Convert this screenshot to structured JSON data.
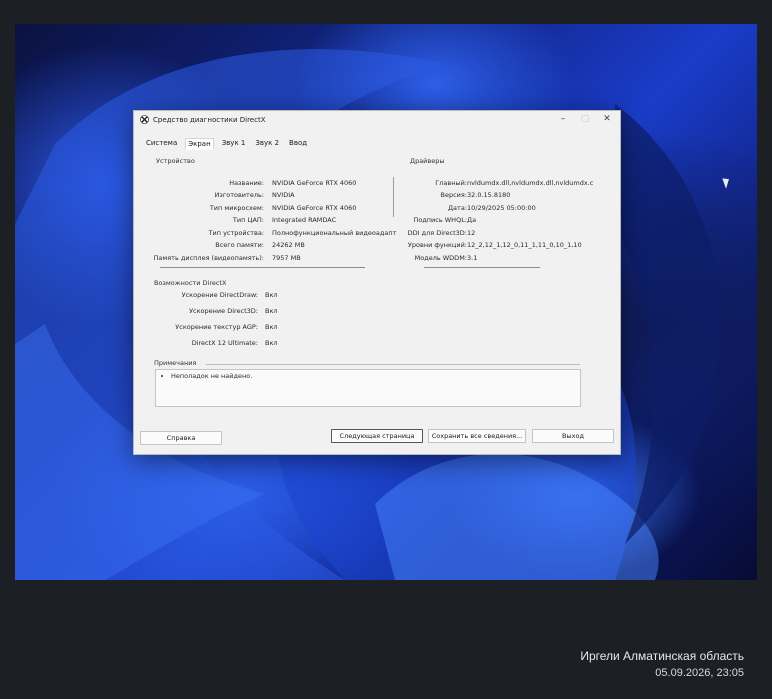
{
  "window": {
    "title": "Средство диагностики DirectX"
  },
  "tabs": [
    {
      "label": "Система"
    },
    {
      "label": "Экран"
    },
    {
      "label": "Звук 1"
    },
    {
      "label": "Звук 2"
    },
    {
      "label": "Ввод"
    }
  ],
  "device": {
    "section_title": "Устройство",
    "rows": [
      {
        "label": "Название:",
        "value": "NVIDIA GeForce RTX 4060"
      },
      {
        "label": "Изготовитель:",
        "value": "NVIDIA"
      },
      {
        "label": "Тип микросхем:",
        "value": "NVIDIA GeForce RTX 4060"
      },
      {
        "label": "Тип ЦАП:",
        "value": "Integrated RAMDAC"
      },
      {
        "label": "Тип устройства:",
        "value": "Полнофункциональный видеоадапт"
      },
      {
        "label": "Всего памяти:",
        "value": "24262 MB"
      },
      {
        "label": "Память дисплея (видеопамять):",
        "value": "7957 MB"
      }
    ]
  },
  "drivers": {
    "section_title": "Драйверы",
    "rows": [
      {
        "label": "Главный:",
        "value": "nvldumdx.dll,nvldumdx.dll,nvldumdx.c"
      },
      {
        "label": "Версия:",
        "value": "32.0.15.8180"
      },
      {
        "label": "Дата:",
        "value": "10/29/2025 05:00:00"
      },
      {
        "label": "Подпись WHQL:",
        "value": "Да"
      },
      {
        "label": "DDI для Direct3D:",
        "value": "12"
      },
      {
        "label": "Уровни функций:",
        "value": "12_2,12_1,12_0,11_1,11_0,10_1,10"
      },
      {
        "label": "Модель WDDM:",
        "value": "3.1"
      }
    ]
  },
  "directx": {
    "section_title": "Возможности DirectX",
    "rows": [
      {
        "label": "Ускорение DirectDraw:",
        "value": "Вкл"
      },
      {
        "label": "Ускорение Direct3D:",
        "value": "Вкл"
      },
      {
        "label": "Ускорение текстур AGP:",
        "value": "Вкл"
      },
      {
        "label": "DirectX 12 Ultimate:",
        "value": "Вкл"
      }
    ]
  },
  "notes": {
    "section_title": "Примечания",
    "items": [
      "Неполадок не найдено."
    ]
  },
  "buttons": {
    "help": "Справка",
    "next_page": "Следующая страница",
    "save_all": "Сохранить все сведения...",
    "exit": "Выход"
  },
  "photo_caption": {
    "location": "Иргели Алматинская область",
    "datetime": "05.09.2026, 23:05"
  }
}
